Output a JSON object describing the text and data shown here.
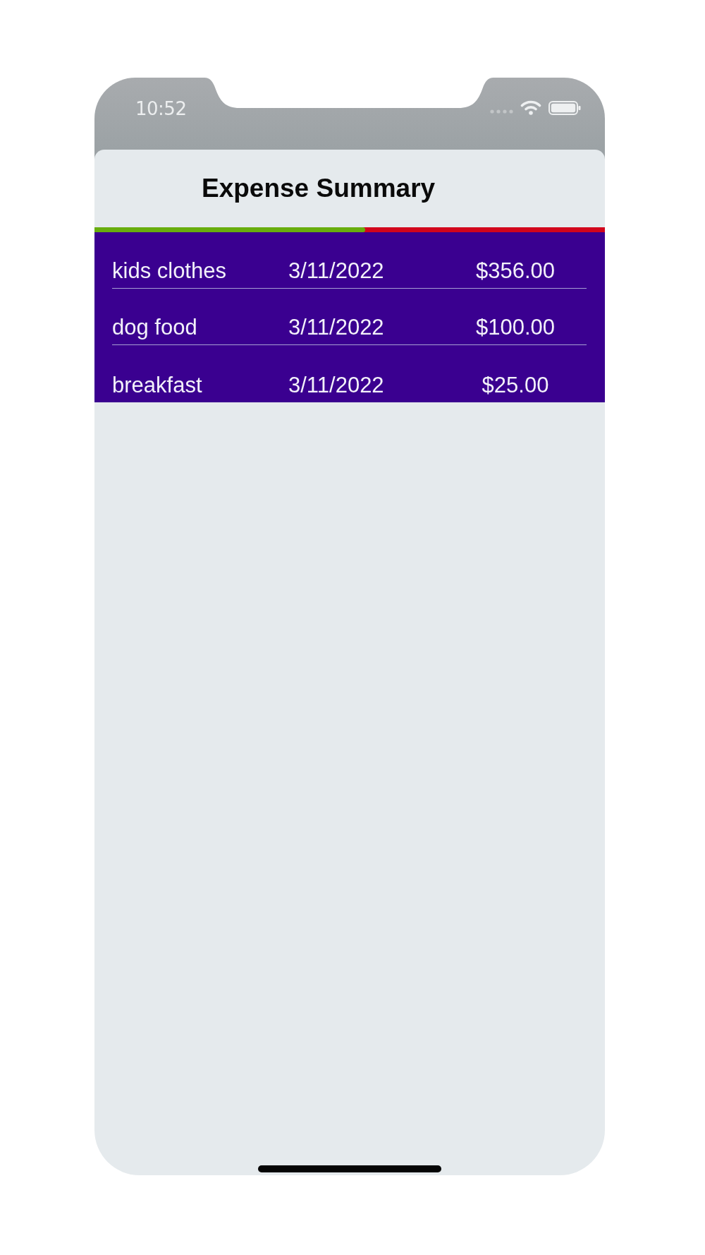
{
  "status_bar": {
    "time": "10:52"
  },
  "header": {
    "title": "Expense Summary"
  },
  "budget_bar": {
    "level": 0.53
  },
  "expenses": [
    {
      "name": "kids clothes",
      "date": "3/11/2022",
      "amount": "$356.00"
    },
    {
      "name": "dog food",
      "date": "3/11/2022",
      "amount": "$100.00"
    },
    {
      "name": "breakfast",
      "date": "3/11/2022",
      "amount": "$25.00"
    }
  ]
}
